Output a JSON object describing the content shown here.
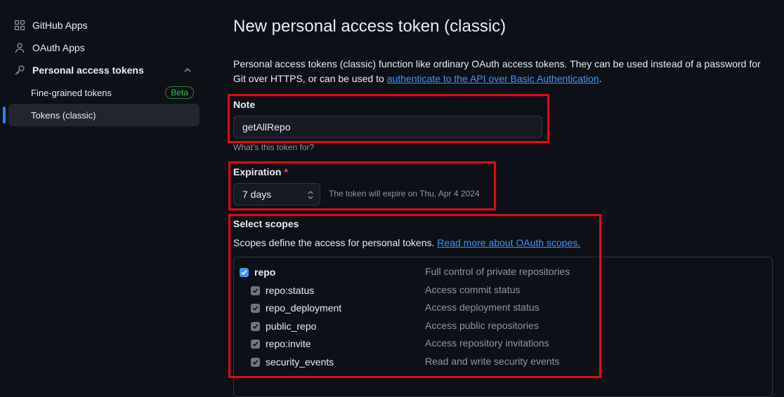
{
  "sidebar": {
    "items": [
      {
        "label": "GitHub Apps",
        "icon": "apps-grid-icon"
      },
      {
        "label": "OAuth Apps",
        "icon": "person-icon"
      },
      {
        "label": "Personal access tokens",
        "icon": "key-icon"
      }
    ],
    "sub_items": [
      {
        "label": "Fine-grained tokens",
        "badge": "Beta"
      },
      {
        "label": "Tokens (classic)"
      }
    ]
  },
  "main": {
    "title": "New personal access token (classic)",
    "intro_text": "Personal access tokens (classic) function like ordinary OAuth access tokens. They can be used instead of a password for Git over HTTPS, or can be used to ",
    "intro_link": "authenticate to the API over Basic Authentication",
    "intro_end": ".",
    "note": {
      "label": "Note",
      "value": "getAllRepo",
      "hint": "What’s this token for?"
    },
    "expiration": {
      "label": "Expiration",
      "required_mark": "*",
      "selected": "7 days",
      "hint": "The token will expire on Thu, Apr 4 2024"
    },
    "scopes": {
      "label": "Select scopes",
      "description": "Scopes define the access for personal tokens.",
      "link": "Read more about OAuth scopes.",
      "items": [
        {
          "name": "repo",
          "desc": "Full control of private repositories",
          "checked": true
        },
        {
          "name": "repo:status",
          "desc": "Access commit status",
          "checked": true
        },
        {
          "name": "repo_deployment",
          "desc": "Access deployment status",
          "checked": true
        },
        {
          "name": "public_repo",
          "desc": "Access public repositories",
          "checked": true
        },
        {
          "name": "repo:invite",
          "desc": "Access repository invitations",
          "checked": true
        },
        {
          "name": "security_events",
          "desc": "Read and write security events",
          "checked": true
        }
      ]
    }
  },
  "colors": {
    "background": "#0d1117",
    "accent": "#4493f8",
    "highlight": "#e50914",
    "beta": "#3fb950"
  }
}
